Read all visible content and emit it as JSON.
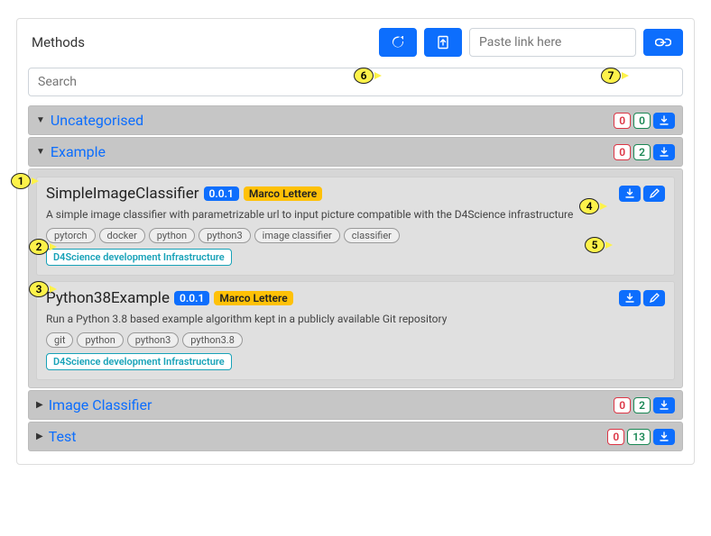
{
  "header": {
    "title": "Methods",
    "link_placeholder": "Paste link here",
    "search_placeholder": "Search"
  },
  "annotations": [
    "1",
    "2",
    "3",
    "4",
    "5",
    "6",
    "7"
  ],
  "categories": [
    {
      "name": "Uncategorised",
      "expanded": true,
      "counts": {
        "red": "0",
        "green": "0"
      },
      "children": [
        {
          "type": "category",
          "name": "Example",
          "expanded": true,
          "counts": {
            "red": "0",
            "green": "2"
          },
          "methods": [
            {
              "name": "SimpleImageClassifier",
              "version": "0.0.1",
              "author": "Marco Lettere",
              "description": "A simple image classifier with parametrizable url to input picture compatible with the D4Science infrastructure",
              "tags": [
                "pytorch",
                "docker",
                "python",
                "python3",
                "image classifier",
                "classifier"
              ],
              "infra": "D4Science development Infrastructure"
            },
            {
              "name": "Python38Example",
              "version": "0.0.1",
              "author": "Marco Lettere",
              "description": "Run a Python 3.8 based example algorithm kept in a publicly available Git repository",
              "tags": [
                "git",
                "python",
                "python3",
                "python3.8"
              ],
              "infra": "D4Science development Infrastructure"
            }
          ]
        },
        {
          "type": "category",
          "name": "Image Classifier",
          "expanded": false,
          "counts": {
            "red": "0",
            "green": "2"
          }
        },
        {
          "type": "category",
          "name": "Test",
          "expanded": false,
          "counts": {
            "red": "0",
            "green": "13"
          }
        }
      ]
    }
  ]
}
